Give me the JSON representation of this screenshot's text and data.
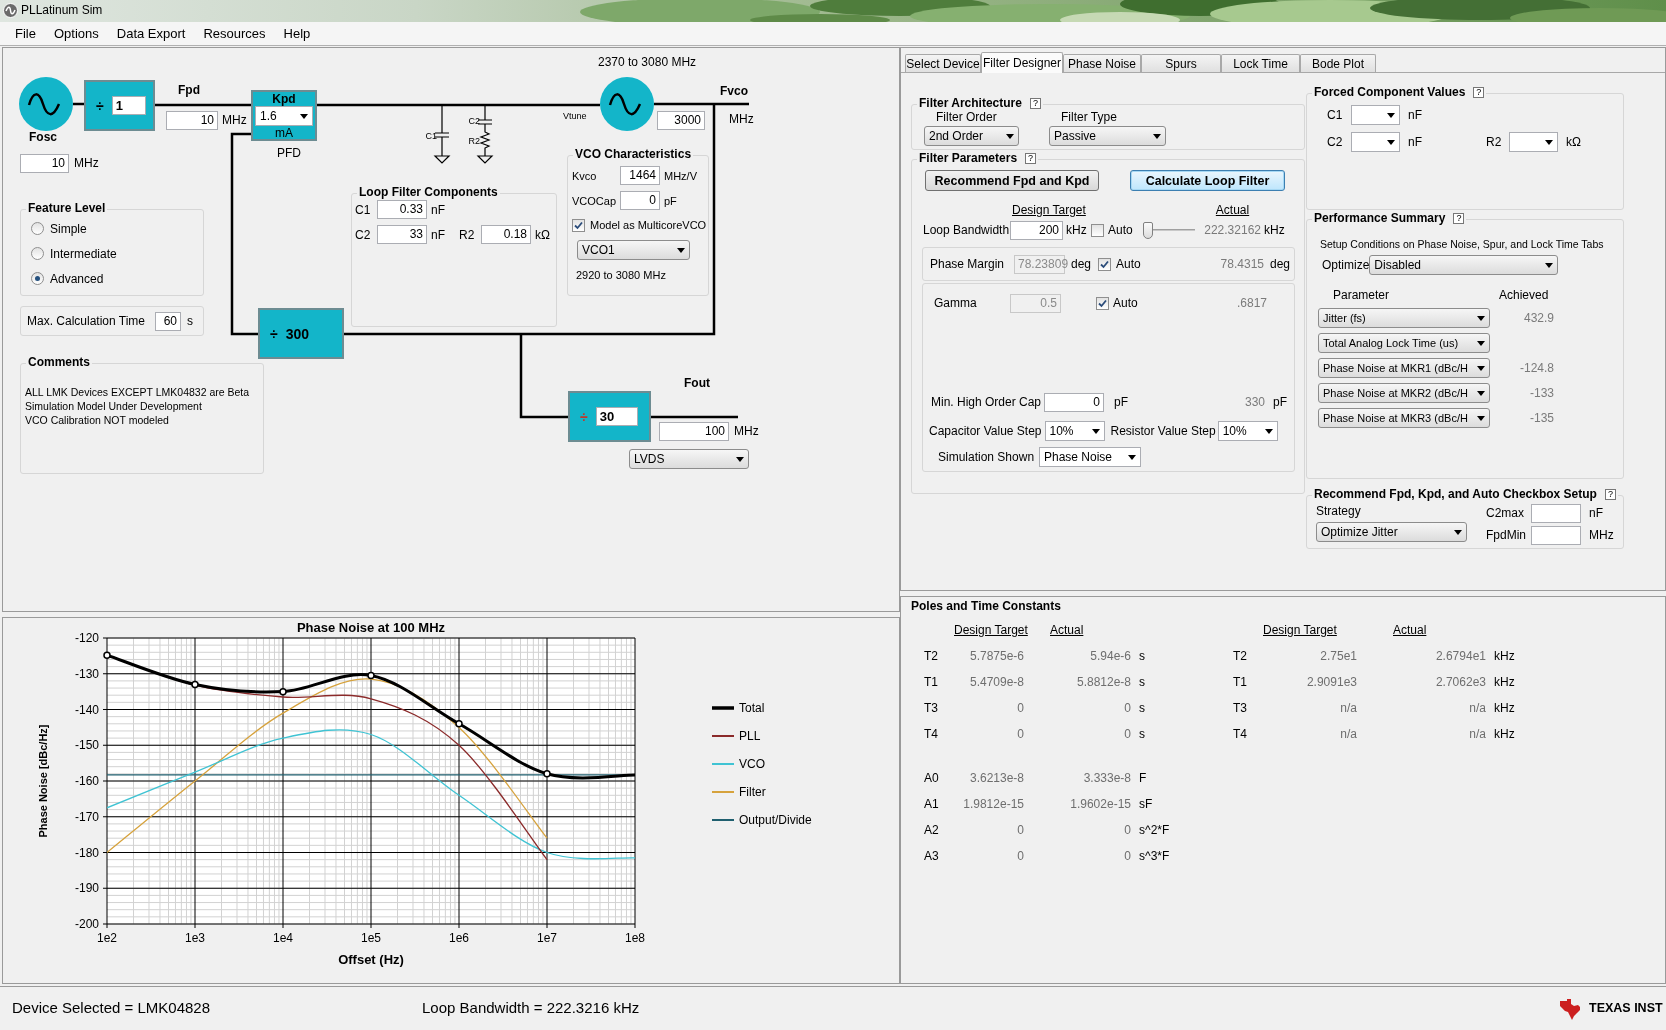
{
  "window": {
    "title": "PLLatinum Sim"
  },
  "menu": [
    "File",
    "Options",
    "Data Export",
    "Resources",
    "Help"
  ],
  "diagram": {
    "oscillator": {
      "label": "Fosc",
      "value": "10",
      "unit": "MHz"
    },
    "ref_divider": {
      "symbol": "÷",
      "value": "1"
    },
    "fpd": {
      "label": "Fpd",
      "value": "10",
      "unit": "MHz"
    },
    "pfd": {
      "label": "Kpd",
      "value": "1.6",
      "unit": "mA",
      "caption": "PFD"
    },
    "loop_filter_schematic": {
      "labels": [
        "C1",
        "C2",
        "R2"
      ]
    },
    "vco": {
      "range": "2370 to 3080 MHz",
      "vtune_label": "Vtune",
      "label": "Fvco",
      "value": "3000",
      "unit": "MHz"
    },
    "n_divider": {
      "symbol": "÷",
      "value": "300"
    },
    "out_divider": {
      "symbol": "÷",
      "value": "30"
    },
    "fout": {
      "label": "Fout",
      "value": "100",
      "unit": "MHz",
      "format": "LVDS"
    },
    "feature_level": {
      "title": "Feature Level",
      "options": [
        {
          "label": "Simple",
          "selected": false
        },
        {
          "label": "Intermediate",
          "selected": false
        },
        {
          "label": "Advanced",
          "selected": true
        }
      ]
    },
    "max_calc_time": {
      "label": "Max. Calculation Time",
      "value": "60",
      "unit": "s"
    },
    "comments": {
      "title": "Comments",
      "lines": [
        "ALL LMK Devices EXCEPT LMK04832 are Beta",
        "Simulation Model Under Development",
        "VCO Calibration NOT modeled"
      ]
    },
    "loop_filter_components": {
      "title": "Loop Filter Components",
      "fields": [
        {
          "label": "C1",
          "value": "0.33",
          "unit": "nF"
        },
        {
          "label": "C2",
          "value": "33",
          "unit": "nF"
        },
        {
          "label": "R2",
          "value": "0.18",
          "unit": "kΩ"
        }
      ]
    },
    "vco_characteristics": {
      "title": "VCO Characteristics",
      "fields": [
        {
          "label": "Kvco",
          "value": "1464",
          "unit": "MHz/V"
        },
        {
          "label": "VCOCap",
          "value": "0",
          "unit": "pF"
        }
      ],
      "multicore": {
        "label": "Model as MulticoreVCO",
        "checked": true
      },
      "core": "VCO1",
      "core_range": "2920 to 3080 MHz"
    }
  },
  "chart": {
    "chart_data": {
      "type": "line",
      "title": "Phase Noise at 100 MHz",
      "xlabel": "Offset (Hz)",
      "ylabel": "Phase Noise [dBc/Hz]",
      "categories": [
        "1e2",
        "1e3",
        "1e4",
        "1e5",
        "1e6",
        "1e7",
        "1e8"
      ],
      "ylim": [
        -200,
        -120
      ],
      "grid": true,
      "legend": "right",
      "yticks": [
        -200,
        -190,
        -180,
        -170,
        -160,
        -150,
        -140,
        -130,
        -120
      ],
      "series": [
        {
          "name": "Total",
          "color": "#000000",
          "marker": "circle",
          "values": [
            -124.8,
            -133,
            -135,
            -130.5,
            -144,
            -158,
            -158.3
          ]
        },
        {
          "name": "PLL",
          "color": "#8b2a2a",
          "values": [
            -124.8,
            -133.2,
            -136.5,
            -137,
            -150,
            -182,
            null
          ]
        },
        {
          "name": "VCO",
          "color": "#3fc3d3",
          "values": [
            -167.5,
            -157.5,
            -148,
            -147,
            -164,
            -180,
            -181.5
          ]
        },
        {
          "name": "Filter",
          "color": "#d6a23c",
          "values": [
            -180,
            -160,
            -141,
            -131.5,
            -145,
            -176,
            null
          ]
        },
        {
          "name": "Output/Divide",
          "color": "#1f5f6f",
          "values": [
            -158.3,
            -158.3,
            -158.3,
            -158.3,
            -158.3,
            -158.3,
            -158.3
          ]
        }
      ]
    }
  },
  "tabs": [
    {
      "label": "Select Device",
      "selected": false
    },
    {
      "label": "Filter Designer",
      "selected": true
    },
    {
      "label": "Phase Noise",
      "selected": false
    },
    {
      "label": "Spurs",
      "selected": false
    },
    {
      "label": "Lock Time",
      "selected": false
    },
    {
      "label": "Bode Plot",
      "selected": false
    }
  ],
  "filter_designer": {
    "filter_architecture": {
      "title": "Filter Architecture",
      "help": "?",
      "fields": [
        {
          "label": "Filter Order",
          "value": "2nd Order"
        },
        {
          "label": "Filter Type",
          "value": "Passive"
        }
      ]
    },
    "filter_parameters": {
      "title": "Filter Parameters",
      "help": "?",
      "buttons": [
        {
          "label": "Recommend Fpd and Kpd",
          "focused": false
        },
        {
          "label": "Calculate Loop Filter",
          "focused": true
        }
      ],
      "headers": [
        "Design Target",
        "Actual"
      ],
      "loop_bandwidth": {
        "label": "Loop Bandwidth",
        "value": "200",
        "unit": "kHz",
        "auto_label": "Auto",
        "auto": false,
        "level": 0,
        "actual": "222.32162",
        "actual_unit": "kHz"
      },
      "phase_margin": {
        "label": "Phase Margin",
        "value": "78.23809",
        "unit": "deg",
        "auto_label": "Auto",
        "auto": true,
        "actual": "78.4315",
        "actual_unit": "deg"
      },
      "gamma": {
        "label": "Gamma",
        "value": "0.5",
        "auto_label": "Auto",
        "auto": true,
        "actual": ".6817"
      },
      "min_high_order_cap": {
        "label": "Min. High Order Cap",
        "value": "0",
        "unit": "pF",
        "actual": "330",
        "actual_unit": "pF"
      },
      "capacitor_step": {
        "label": "Capacitor Value Step",
        "value": "10%"
      },
      "resistor_step": {
        "label": "Resistor Value Step",
        "value": "10%"
      },
      "simulation_shown": {
        "label": "Simulation Shown",
        "value": "Phase Noise"
      }
    },
    "forced_components": {
      "title": "Forced Component Values",
      "help": "?",
      "fields": [
        {
          "label": "C1",
          "unit": "nF"
        },
        {
          "label": "C2",
          "unit": "nF"
        },
        {
          "label": "R2",
          "unit": "kΩ"
        }
      ]
    },
    "performance_summary": {
      "title": "Performance Summary",
      "help": "?",
      "note": "Setup Conditions on Phase Noise, Spur, and Lock Time Tabs",
      "optimize_label": "Optimize",
      "optimize": "Disabled",
      "headers": [
        "Parameter",
        "Achieved"
      ],
      "rows": [
        {
          "parameter": "Jitter (fs)",
          "achieved": "432.9"
        },
        {
          "parameter": "Total Analog Lock Time (us)"
        },
        {
          "parameter": "Phase Noise at MKR1 (dBc/H",
          "achieved": "-124.8"
        },
        {
          "parameter": "Phase Noise at MKR2 (dBc/H",
          "achieved": "-133"
        },
        {
          "parameter": "Phase Noise at MKR3 (dBc/H",
          "achieved": "-135"
        }
      ]
    },
    "recommend_setup": {
      "title": "Recommend Fpd, Kpd, and Auto Checkbox Setup",
      "help": "?",
      "strategy_label": "Strategy",
      "strategy": "Optimize Jitter",
      "fields": [
        {
          "label": "C2max",
          "unit": "nF"
        },
        {
          "label": "FpdMin",
          "unit": "MHz"
        }
      ]
    }
  },
  "poles": {
    "title": "Poles and Time Constants",
    "time_constants": {
      "headers": [
        "Design Target",
        "Actual"
      ],
      "rows": [
        {
          "label": "T2",
          "target": "5.7875e-6",
          "actual": "5.94e-6",
          "unit": "s"
        },
        {
          "label": "T1",
          "target": "5.4709e-8",
          "actual": "5.8812e-8",
          "unit": "s"
        },
        {
          "label": "T3",
          "target": "0",
          "actual": "0",
          "unit": "s"
        },
        {
          "label": "T4",
          "target": "0",
          "actual": "0",
          "unit": "s"
        }
      ]
    },
    "coefficients": [
      {
        "label": "A0",
        "target": "3.6213e-8",
        "actual": "3.333e-8",
        "unit": "F"
      },
      {
        "label": "A1",
        "target": "1.9812e-15",
        "actual": "1.9602e-15",
        "unit": "sF"
      },
      {
        "label": "A2",
        "target": "0",
        "actual": "0",
        "unit": "s^2*F"
      },
      {
        "label": "A3",
        "target": "0",
        "actual": "0",
        "unit": "s^3*F"
      }
    ],
    "pole_frequencies": {
      "headers": [
        "Design Target",
        "Actual"
      ],
      "rows": [
        {
          "label": "T2",
          "target": "2.75e1",
          "actual": "2.6794e1",
          "unit": "kHz"
        },
        {
          "label": "T1",
          "target": "2.9091e3",
          "actual": "2.7062e3",
          "unit": "kHz"
        },
        {
          "label": "T3",
          "target": "n/a",
          "actual": "n/a",
          "unit": "kHz"
        },
        {
          "label": "T4",
          "target": "n/a",
          "actual": "n/a",
          "unit": "kHz"
        }
      ]
    }
  },
  "status_bar": {
    "device": "Device Selected = LMK04828",
    "loop_bandwidth": "Loop Bandwidth = 222.3216 kHz",
    "logo": "TEXAS INST"
  }
}
